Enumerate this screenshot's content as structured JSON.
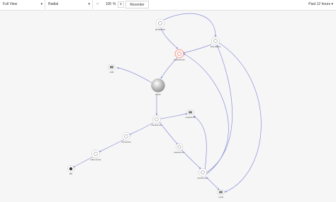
{
  "toolbar": {
    "view_select": "Full View",
    "layout_select": "Radial",
    "zoom_minus": "−",
    "zoom_value": "100",
    "zoom_unit": "%",
    "zoom_plus": "+",
    "recenter_label": "Recenter",
    "time_range": "Past 12 hours",
    "caret": "▾"
  },
  "graph": {
    "colors": {
      "edge": "#8a8fd8",
      "node": "#ffffff",
      "node_border": "#bdbdbd",
      "highlight": "#f08a7a",
      "core": "#b0b0b0"
    },
    "nodes": [
      {
        "id": "n1",
        "label": "api-gateway",
        "icon": "service-icon"
      },
      {
        "id": "n2",
        "label": "auth-service",
        "icon": "service-icon"
      },
      {
        "id": "n3",
        "label": "frontend-web",
        "icon": "service-icon",
        "status": "error"
      },
      {
        "id": "n4",
        "label": "redis",
        "icon": "database-icon"
      },
      {
        "id": "n5",
        "label": "cluster",
        "icon": "cluster-icon"
      },
      {
        "id": "n6",
        "label": "checkout-svc",
        "icon": "service-icon"
      },
      {
        "id": "n7",
        "label": "postgres-db",
        "icon": "database-icon"
      },
      {
        "id": "n8",
        "label": "cart-service",
        "icon": "service-icon"
      },
      {
        "id": "n9",
        "label": "order-service",
        "icon": "service-icon"
      },
      {
        "id": "n10",
        "label": "k8s",
        "icon": "host-icon"
      },
      {
        "id": "n11",
        "label": "payment-svc",
        "icon": "service-icon"
      },
      {
        "id": "n12",
        "label": "inventory-svc",
        "icon": "service-icon"
      },
      {
        "id": "n13",
        "label": "mysql",
        "icon": "database-icon"
      }
    ]
  }
}
